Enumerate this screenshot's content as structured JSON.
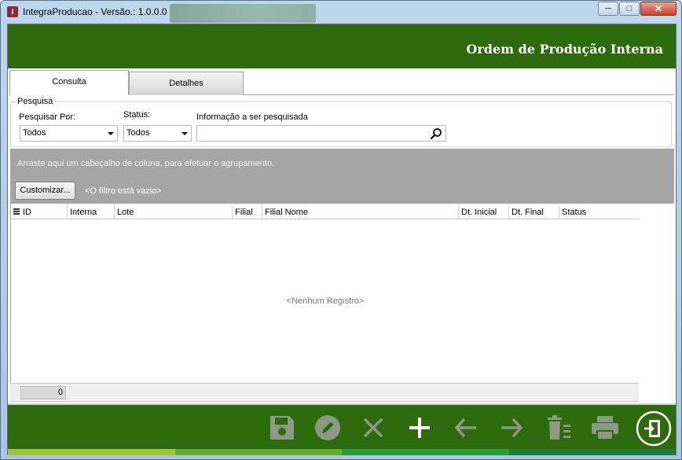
{
  "window": {
    "title": "IntegraProducao - Versão.: 1.0.0.0",
    "app_icon": "app-icon",
    "controls": {
      "minimize": "─",
      "maximize": "□",
      "close": "✕"
    }
  },
  "header": {
    "title": "Ordem de Produção Interna",
    "bg_color": "#2e6b0f"
  },
  "tabs": [
    {
      "label": "Consulta",
      "active": true
    },
    {
      "label": "Detalhes",
      "active": false
    }
  ],
  "search": {
    "group_title": "Pesquisa",
    "search_by_label": "Pesquisar Por:",
    "search_by_value": "Todos",
    "status_label": "Status:",
    "status_value": "Todos",
    "info_label": "Informação a ser pesquisada",
    "info_value": "",
    "search_icon": "magnifier-icon"
  },
  "grid": {
    "group_hint": "Arraste aqui um cabeçalho de coluna, para efetuar o agrupamento.",
    "customize_label": "Customizar...",
    "filter_empty": "<O filtro está vazio>",
    "columns": [
      "ID",
      "Interna",
      "Lote",
      "Filial",
      "Filial Nome",
      "Dt. Inicial",
      "Dt. Final",
      "Status"
    ],
    "empty_message": "<Nenhum Registro>",
    "footer_count": "0"
  },
  "toolbar": {
    "buttons": [
      {
        "name": "save-icon",
        "enabled": false
      },
      {
        "name": "edit-icon",
        "enabled": false
      },
      {
        "name": "cancel-icon",
        "enabled": false
      },
      {
        "name": "add-icon",
        "enabled": true
      },
      {
        "name": "previous-icon",
        "enabled": false
      },
      {
        "name": "next-icon",
        "enabled": false
      },
      {
        "name": "delete-icon",
        "enabled": false
      },
      {
        "name": "print-icon",
        "enabled": false
      },
      {
        "name": "exit-icon",
        "enabled": true
      }
    ],
    "stripe_colors": [
      "#9ec437",
      "#5fae2e",
      "#2f9a3b",
      "#1f7d3c"
    ]
  }
}
